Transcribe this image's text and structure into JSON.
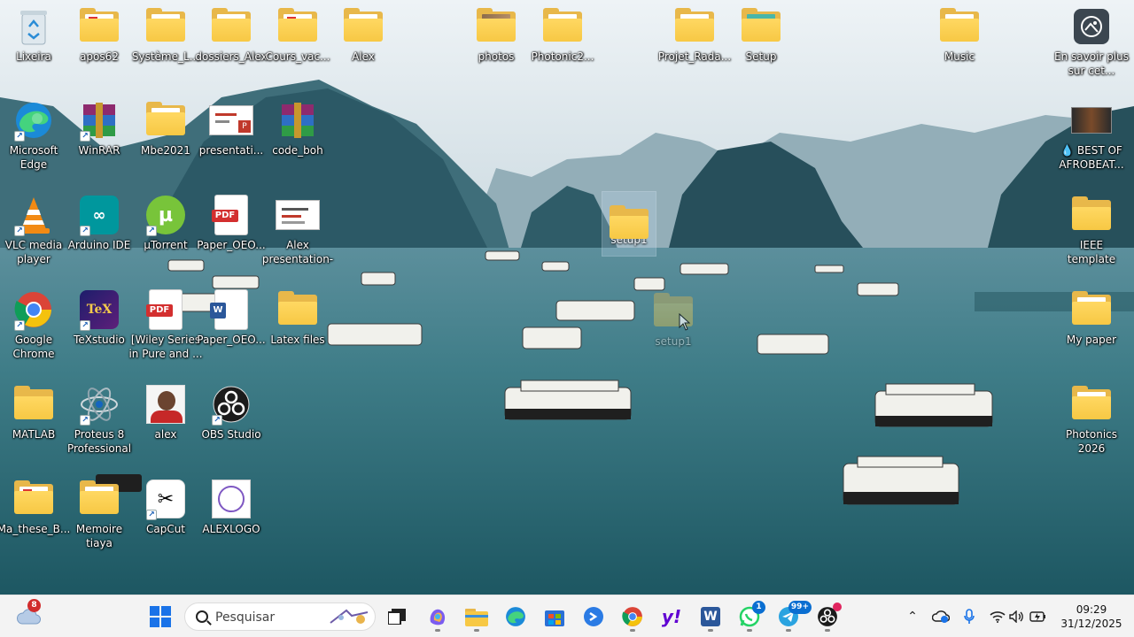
{
  "desktop": {
    "icons": [
      {
        "id": "recycle",
        "label": "Lixeira"
      },
      {
        "id": "apos62",
        "label": "apos62"
      },
      {
        "id": "systeme",
        "label": "Système_L..."
      },
      {
        "id": "dossiers",
        "label": "dossiers_Alex"
      },
      {
        "id": "cours",
        "label": "Cours_vac..."
      },
      {
        "id": "alex_folder",
        "label": "Alex"
      },
      {
        "id": "photos",
        "label": "photos"
      },
      {
        "id": "photonic2",
        "label": "Photonic2..."
      },
      {
        "id": "projet",
        "label": "Projet_Rada..."
      },
      {
        "id": "setup",
        "label": "Setup"
      },
      {
        "id": "music",
        "label": "Music"
      },
      {
        "id": "ensavoir",
        "label": "En savoir plus sur cet..."
      },
      {
        "id": "edge",
        "label": "Microsoft Edge"
      },
      {
        "id": "winrar",
        "label": "WinRAR"
      },
      {
        "id": "mbe",
        "label": "Mbe2021"
      },
      {
        "id": "presentati",
        "label": "presentati..."
      },
      {
        "id": "codebob",
        "label": "code_boh"
      },
      {
        "id": "bestof",
        "label": "💧 BEST OF AFROBEAT..."
      },
      {
        "id": "vlc",
        "label": "VLC media player"
      },
      {
        "id": "arduino",
        "label": "Arduino IDE"
      },
      {
        "id": "utorrent",
        "label": "µTorrent"
      },
      {
        "id": "paperpdf",
        "label": "Paper_OEO..."
      },
      {
        "id": "alexpres",
        "label": "Alex presentation-"
      },
      {
        "id": "setup1",
        "label": "setup1"
      },
      {
        "id": "ieee",
        "label": "IEEE template"
      },
      {
        "id": "chrome",
        "label": "Google Chrome"
      },
      {
        "id": "texstudio",
        "label": "TeXstudio"
      },
      {
        "id": "wiley",
        "label": "[Wiley Series in Pure and ..."
      },
      {
        "id": "paperword",
        "label": "Paper_OEO..."
      },
      {
        "id": "latex",
        "label": "Latex files"
      },
      {
        "id": "dragging",
        "label": "setup1"
      },
      {
        "id": "mypaper",
        "label": "My paper"
      },
      {
        "id": "matlab",
        "label": "MATLAB"
      },
      {
        "id": "proteus",
        "label": "Proteus 8 Professional"
      },
      {
        "id": "alexphoto",
        "label": "alex"
      },
      {
        "id": "obs",
        "label": "OBS Studio"
      },
      {
        "id": "photonics2026",
        "label": "Photonics 2026"
      },
      {
        "id": "mathese",
        "label": "Ma_these_B..."
      },
      {
        "id": "memoire",
        "label": "Memoire tiaya"
      },
      {
        "id": "capcut",
        "label": "CapCut"
      },
      {
        "id": "alexlogo",
        "label": "ALEXLOGO"
      }
    ]
  },
  "taskbar": {
    "weather_badge": "8",
    "search_placeholder": "Pesquisar",
    "whatsapp_badge": "1",
    "telegram_badge": "99+",
    "clock_time": "09:29",
    "clock_date": "31/12/2025",
    "accent": "#0a6ed1"
  }
}
